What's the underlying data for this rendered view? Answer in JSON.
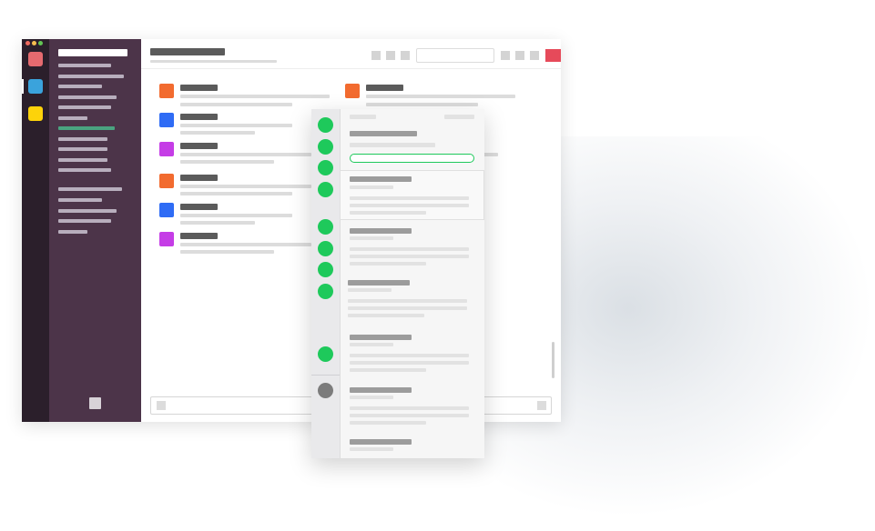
{
  "window": {
    "traffic_lights": [
      "#ee6a5f",
      "#f5be4f",
      "#62c554"
    ]
  },
  "teams": [
    {
      "name": "team-red",
      "color": "#e56a6f"
    },
    {
      "name": "team-blue",
      "color": "#3aa3dc"
    },
    {
      "name": "team-yellow",
      "color": "#fdd30a"
    }
  ],
  "messages": [
    {
      "avatar": "#f26b2f"
    },
    {
      "avatar": "#2f6cf5"
    },
    {
      "avatar": "#c53de6"
    },
    {
      "avatar": "#f26b2f"
    },
    {
      "avatar": "#2f6cf5"
    },
    {
      "avatar": "#c53de6"
    }
  ],
  "right_message": {
    "avatar": "#f26b2f"
  },
  "toolbar": {
    "close_color": "#e64a5a"
  },
  "status_colors": {
    "online": "#1ec95b",
    "offline": "#7c7c7c",
    "highlight": "#4aa380"
  }
}
